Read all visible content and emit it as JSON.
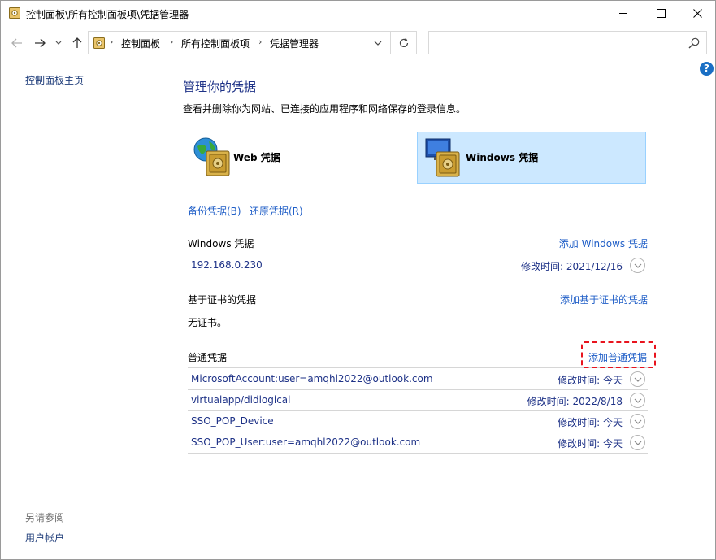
{
  "window": {
    "title": "控制面板\\所有控制面板项\\凭据管理器"
  },
  "address": {
    "crumbs": [
      "控制面板",
      "所有控制面板项",
      "凭据管理器"
    ],
    "separator": "›"
  },
  "search": {
    "placeholder": ""
  },
  "left_pane": {
    "home_link": "控制面板主页",
    "see_also": "另请参阅",
    "user_accounts": "用户帐户"
  },
  "main": {
    "title": "管理你的凭据",
    "description": "查看并删除你为网站、已连接的应用程序和网络保存的登录信息。",
    "vaults": {
      "web": "Web 凭据",
      "windows": "Windows 凭据"
    },
    "backup": "备份凭据(B)",
    "restore": "还原凭据(R)",
    "sections": {
      "windows": {
        "title": "Windows 凭据",
        "action": "添加 Windows 凭据",
        "items": [
          {
            "name": "192.168.0.230",
            "date": "修改时间:  2021/12/16"
          }
        ]
      },
      "certificate": {
        "title": "基于证书的凭据",
        "action": "添加基于证书的凭据",
        "empty": "无证书。"
      },
      "generic": {
        "title": "普通凭据",
        "action": "添加普通凭据",
        "items": [
          {
            "name": "MicrosoftAccount:user=amqhl2022@outlook.com",
            "date": "修改时间:  今天"
          },
          {
            "name": "virtualapp/didlogical",
            "date": "修改时间:  2022/8/18"
          },
          {
            "name": "SSO_POP_Device",
            "date": "修改时间:  今天"
          },
          {
            "name": "SSO_POP_User:user=amqhl2022@outlook.com",
            "date": "修改时间:  今天"
          }
        ]
      }
    }
  },
  "colors": {
    "link": "#1f5ec7",
    "title": "#1e3287",
    "selected_tile_bg": "#cce8ff",
    "highlight": "#e8141e",
    "help_icon": "#1a6fc4"
  }
}
